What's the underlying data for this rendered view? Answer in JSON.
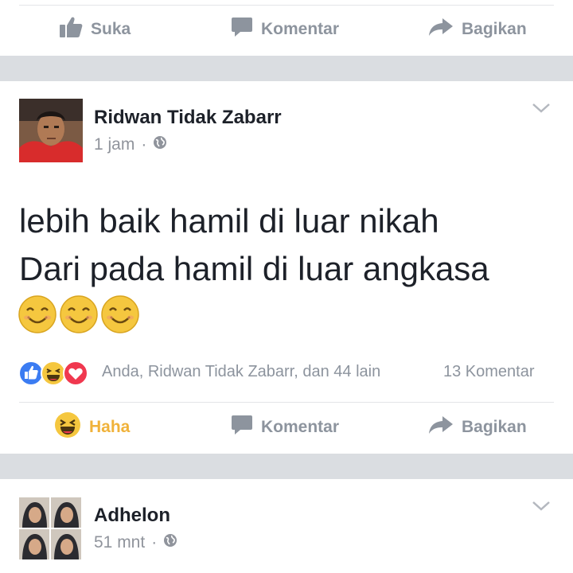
{
  "top_actions": {
    "like": "Suka",
    "comment": "Komentar",
    "share": "Bagikan"
  },
  "post": {
    "author": "Ridwan Tidak Zabarr",
    "time": "1 jam",
    "text_line1": "lebih baik hamil di luar nikah",
    "text_line2": "Dari pada hamil di luar angkasa",
    "emoji": [
      "smiling-face",
      "smiling-face",
      "smiling-face"
    ],
    "reaction_icons": [
      "like",
      "haha",
      "love"
    ],
    "reactions_summary": "Anda, Ridwan Tidak Zabarr, dan 44 lain",
    "comment_count": "13 Komentar",
    "actions": {
      "reaction": "Haha",
      "comment": "Komentar",
      "share": "Bagikan"
    },
    "colors": {
      "haha_label": "#f0b23a",
      "like_blue": "#3b7cf2",
      "love_red": "#f0384f",
      "muted": "#8d949e"
    }
  },
  "next_post": {
    "author": "Adhelon",
    "time": "51 mnt"
  }
}
